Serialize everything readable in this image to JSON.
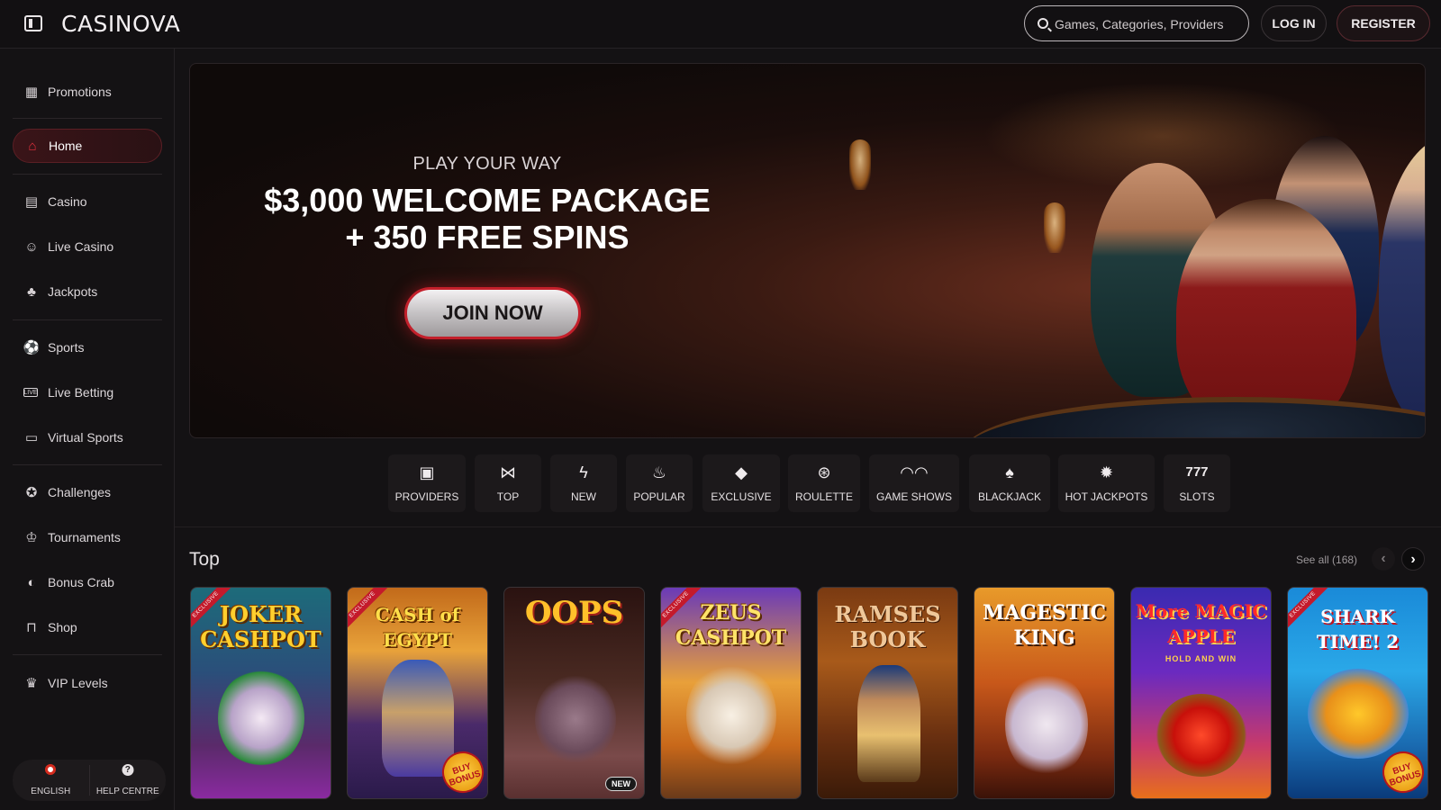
{
  "header": {
    "logo": "CASINOVA",
    "search_placeholder": "Games, Categories, Providers",
    "login_label": "LOG IN",
    "register_label": "REGISTER"
  },
  "sidebar": {
    "items": [
      {
        "label": "Promotions",
        "icon": "gift-icon"
      },
      {
        "label": "Home",
        "icon": "home-icon",
        "active": true
      },
      {
        "label": "Casino",
        "icon": "slot-machine-icon"
      },
      {
        "label": "Live Casino",
        "icon": "live-dealer-icon"
      },
      {
        "label": "Jackpots",
        "icon": "clover-icon"
      },
      {
        "label": "Sports",
        "icon": "soccer-ball-icon"
      },
      {
        "label": "Live Betting",
        "icon": "live-badge-icon"
      },
      {
        "label": "Virtual Sports",
        "icon": "virtual-screen-icon"
      },
      {
        "label": "Challenges",
        "icon": "medal-icon"
      },
      {
        "label": "Tournaments",
        "icon": "trophy-icon"
      },
      {
        "label": "Bonus Crab",
        "icon": "crab-claw-icon"
      },
      {
        "label": "Shop",
        "icon": "shop-icon"
      },
      {
        "label": "VIP Levels",
        "icon": "crown-icon"
      }
    ],
    "language_label": "ENGLISH",
    "help_label": "HELP CENTRE",
    "help_glyph": "?"
  },
  "banner": {
    "kicker": "PLAY YOUR WAY",
    "title_line1": "$3,000 WELCOME PACKAGE",
    "title_line2": "+ 350 FREE SPINS",
    "cta": "JOIN NOW"
  },
  "categories": [
    {
      "label": "PROVIDERS",
      "icon": "cards-icon",
      "glyph": "▣"
    },
    {
      "label": "TOP",
      "icon": "bowtie-icon",
      "glyph": "⋈"
    },
    {
      "label": "NEW",
      "icon": "lightning-icon",
      "glyph": "ϟ"
    },
    {
      "label": "POPULAR",
      "icon": "flame-icon",
      "glyph": "♨"
    },
    {
      "label": "EXCLUSIVE",
      "icon": "diamond-icon",
      "glyph": "◆"
    },
    {
      "label": "ROULETTE",
      "icon": "roulette-icon",
      "glyph": "⊛"
    },
    {
      "label": "GAME SHOWS",
      "icon": "mask-icon",
      "glyph": "◠◠"
    },
    {
      "label": "BLACKJACK",
      "icon": "playing-card-icon",
      "glyph": "♠"
    },
    {
      "label": "HOT JACKPOTS",
      "icon": "fire-coin-icon",
      "glyph": "✹"
    },
    {
      "label": "SLOTS",
      "icon": "seven-icon",
      "glyph": "777"
    }
  ],
  "top_section": {
    "title": "Top",
    "see_all": "See all (168)",
    "prev_glyph": "‹",
    "next_glyph": "›"
  },
  "games": [
    {
      "name": "JOKER CASHPOT",
      "exclusive": true,
      "exclusive_label": "EXCLUSIVE"
    },
    {
      "name": "CASH of EGYPT",
      "exclusive": true,
      "exclusive_label": "EXCLUSIVE",
      "bonus": "BUY BONUS"
    },
    {
      "name": "OOPS",
      "new": "NEW"
    },
    {
      "name": "ZEUS CASHPOT",
      "exclusive": true,
      "exclusive_label": "EXCLUSIVE"
    },
    {
      "name": "RAMSES BOOK"
    },
    {
      "name": "MAGESTIC KING"
    },
    {
      "name": "More MAGIC APPLE",
      "subtitle": "HOLD AND WIN"
    },
    {
      "name": "SHARK TIME! 2",
      "exclusive": true,
      "exclusive_label": "EXCLUSIVE",
      "bonus": "BUY BONUS"
    }
  ],
  "colors": {
    "accent_red": "#c3202b",
    "background": "#141214",
    "panel": "#1c191b"
  }
}
